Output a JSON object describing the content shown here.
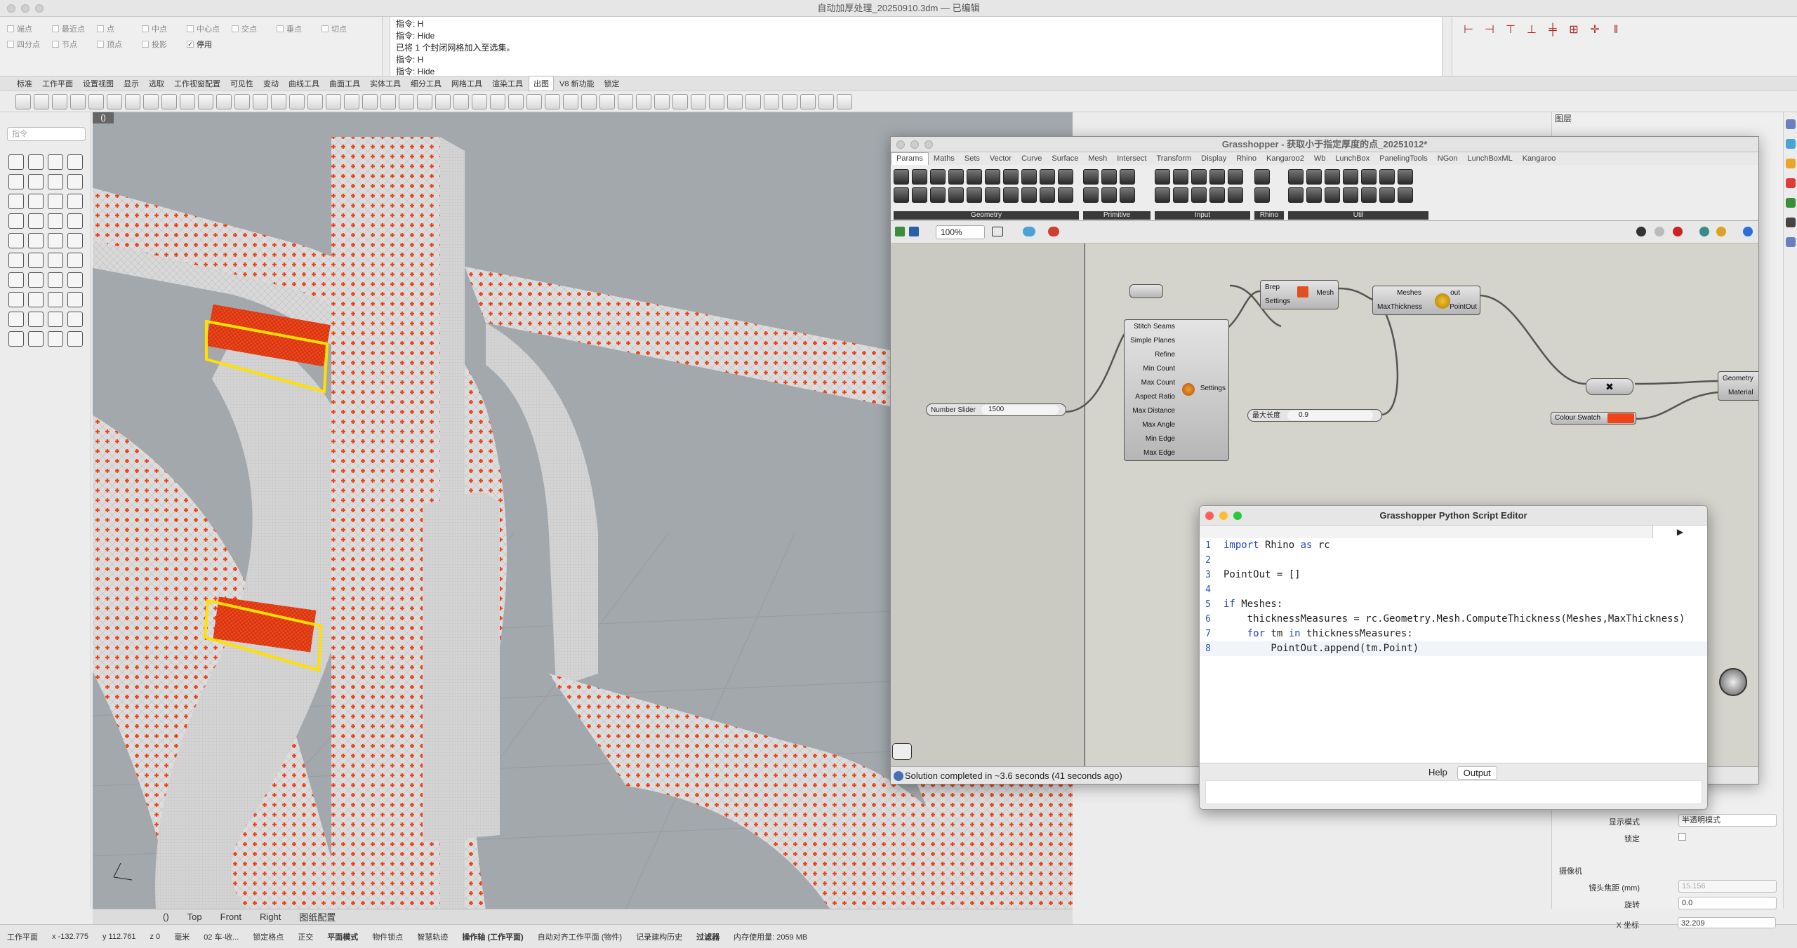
{
  "window": {
    "title": "自动加厚处理_20250910.3dm — 已编辑"
  },
  "snaps": {
    "row1": [
      {
        "label": "端点",
        "on": false
      },
      {
        "label": "最近点",
        "on": false
      },
      {
        "label": "点",
        "on": false
      },
      {
        "label": "中点",
        "on": false
      },
      {
        "label": "中心点",
        "on": false
      },
      {
        "label": "交点",
        "on": false
      },
      {
        "label": "垂点",
        "on": false
      },
      {
        "label": "切点",
        "on": false
      }
    ],
    "row2": [
      {
        "label": "四分点",
        "on": false
      },
      {
        "label": "节点",
        "on": false
      },
      {
        "label": "顶点",
        "on": false
      },
      {
        "label": "投影",
        "on": false
      },
      {
        "label": "停用",
        "on": true
      }
    ]
  },
  "command_history": [
    "指令: H",
    "指令: Hide",
    "已将 1 个封闭网格加入至选集。",
    "指令: H",
    "指令: Hide"
  ],
  "tabs": [
    "标准",
    "工作平面",
    "设置视图",
    "显示",
    "选取",
    "工作视窗配置",
    "可见性",
    "变动",
    "曲线工具",
    "曲面工具",
    "实体工具",
    "细分工具",
    "网格工具",
    "渲染工具",
    "出图",
    "V8 新功能",
    "锁定"
  ],
  "active_tab": "出图",
  "left": {
    "search_placeholder": "指令"
  },
  "viewport": {
    "label": "()",
    "tabs": [
      "Top",
      "Front",
      "Right",
      "图纸配置"
    ],
    "active_label": "()"
  },
  "status": {
    "plane": "工作平面",
    "x": "x -132.775",
    "y": "y 112.761",
    "z": "z 0",
    "unit": "毫米",
    "layer": "02 车-收...",
    "items": [
      "锁定格点",
      "正交",
      "平面模式",
      "物件锁点",
      "智慧轨迹",
      "操作轴 (工作平面)",
      "自动对齐工作平面 (物件)",
      "记录建构历史",
      "过滤器",
      "内存使用量: 2059 MB"
    ],
    "bold": [
      "平面模式",
      "操作轴 (工作平面)",
      "过滤器"
    ]
  },
  "rpanel": {
    "header": "图层",
    "display_mode_label": "显示模式",
    "display_mode_value": "半透明模式",
    "lock_label": "锁定",
    "camera_header": "摄像机",
    "focal_label": "镜头焦距 (mm)",
    "focal_value": "15.156",
    "rotation_label": "旋转",
    "rotation_value": "0.0",
    "xcoord_label": "X 坐标",
    "xcoord_value": "32.209"
  },
  "grasshopper": {
    "title": "Grasshopper - 获取小于指定厚度的点_20251012*",
    "tabs": [
      "Params",
      "Maths",
      "Sets",
      "Vector",
      "Curve",
      "Surface",
      "Mesh",
      "Intersect",
      "Transform",
      "Display",
      "Rhino",
      "Kangaroo2",
      "Wb",
      "LunchBox",
      "PanelingTools",
      "NGon",
      "LunchBoxML",
      "Kangaroo"
    ],
    "active_tab": "Params",
    "groups": [
      "Geometry",
      "Primitive",
      "Input",
      "Rhino",
      "Util"
    ],
    "zoom": "100%",
    "status": "Solution completed in ~3.6 seconds (41 seconds ago)",
    "nodes": {
      "slider_label": "Number Slider",
      "slider_value": "1500",
      "settings_inputs": [
        "Stitch Seams",
        "Simple Planes",
        "Refine",
        "Min Count",
        "Max Count",
        "Aspect Ratio",
        "Max Distance",
        "Max Angle",
        "Min Edge",
        "Max Edge"
      ],
      "settings_output": "Settings",
      "brep_in": [
        "Brep",
        "Settings"
      ],
      "brep_out": "Mesh",
      "py_in": [
        "Meshes",
        "MaxThickness"
      ],
      "py_out": [
        "out",
        "PointOut"
      ],
      "max_len_label": "最大长度",
      "max_len_value": "0.9",
      "preview_in": [
        "Geometry",
        "Material"
      ],
      "swatch_label": "Colour Swatch"
    }
  },
  "python": {
    "title": "Grasshopper Python Script Editor",
    "run": "▶",
    "lines": [
      "import Rhino as rc",
      "",
      "PointOut = []",
      "",
      "if Meshes:",
      "    thicknessMeasures = rc.Geometry.Mesh.ComputeThickness(Meshes,MaxThickness)",
      "    for tm in thicknessMeasures:",
      "        PointOut.append(tm.Point)"
    ],
    "help": "Help",
    "output": "Output"
  }
}
